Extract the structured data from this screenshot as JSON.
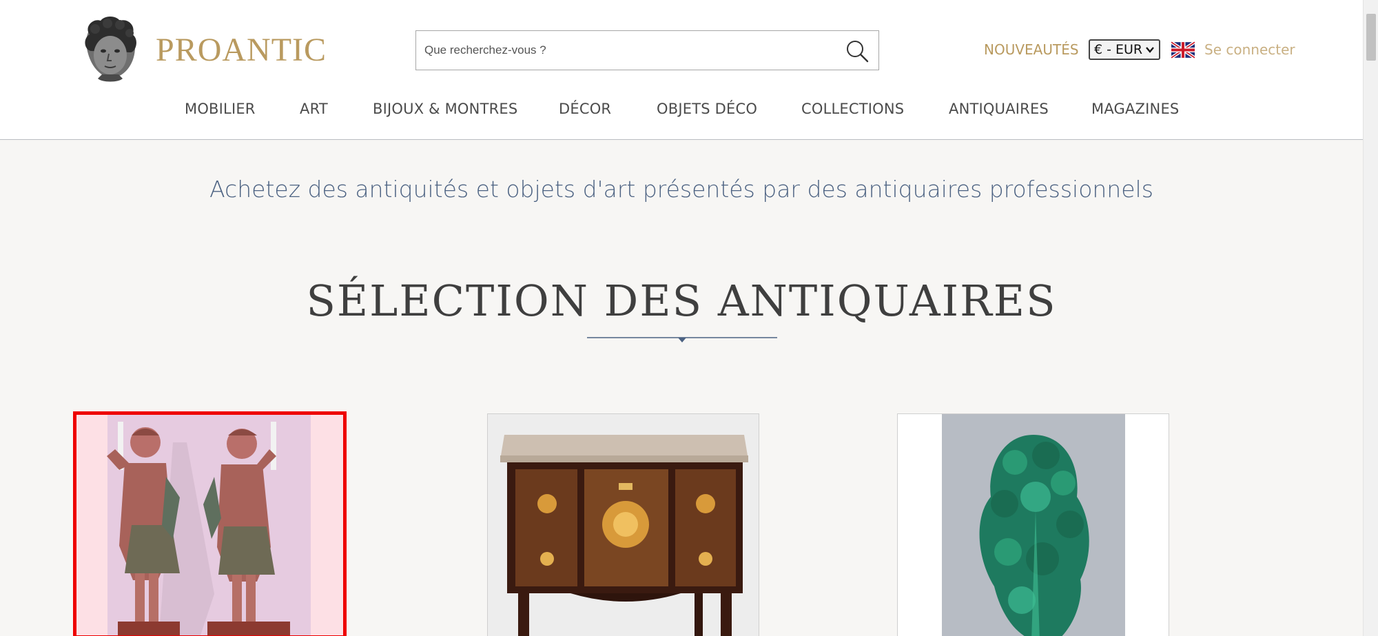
{
  "brand": {
    "name": "PROANTIC",
    "logo_icon": "cherub-head-logo"
  },
  "search": {
    "placeholder": "Que recherchez-vous ?",
    "value": "",
    "icon": "search-icon"
  },
  "header": {
    "new_label": "NOUVEAUTÉS",
    "currency": "€ - EUR",
    "language_flag": "uk-flag-icon",
    "login_label": "Se connecter"
  },
  "nav": {
    "items": [
      {
        "label": "MOBILIER"
      },
      {
        "label": "ART"
      },
      {
        "label": "BIJOUX & MONTRES"
      },
      {
        "label": "DÉCOR"
      },
      {
        "label": "OBJETS DÉCO"
      },
      {
        "label": "COLLECTIONS"
      },
      {
        "label": "ANTIQUAIRES"
      },
      {
        "label": "MAGAZINES"
      }
    ]
  },
  "main": {
    "tagline": "Achetez des antiquités et objets d'art présentés par des antiquaires professionnels",
    "section_title": "SÉLECTION DES ANTIQUAIRES"
  },
  "products": [
    {
      "image": "pair-of-carved-angel-candle-holders"
    },
    {
      "image": "marquetry-commode-with-marble-top"
    },
    {
      "image": "malachite-tree-sculpture"
    }
  ],
  "colors": {
    "gold": "#b99a5f",
    "tagline_blue": "#4c6282",
    "selected_border": "#ee0000",
    "background": "#f7f6f4"
  }
}
